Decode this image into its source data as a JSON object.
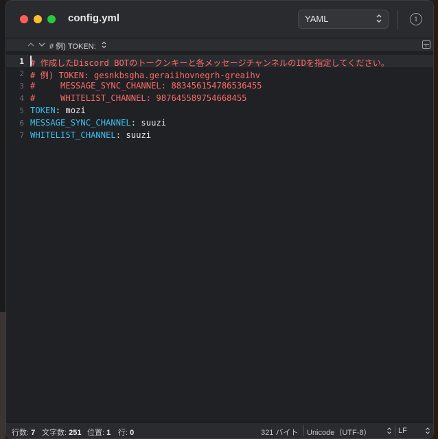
{
  "window": {
    "title": "config.yml",
    "syntax_mode": "YAML"
  },
  "navbar": {
    "breadcrumb": "# 例) TOKEN:"
  },
  "editor": {
    "current_line": 1,
    "lines": [
      {
        "number": "1",
        "comment": "# 作成したDiscord BOTのトークンキーと各メッセージチャンネルのIDを指定してください。"
      },
      {
        "number": "2",
        "comment": "# 例) TOKEN: gesnkbsgha.geraiihovnegrh-greaihv"
      },
      {
        "number": "3",
        "comment": "#     MESSAGE_SYNC_CHANNEL: 883456154786536455"
      },
      {
        "number": "4",
        "comment": "#     WHITELIST_CHANNEL: 987645589754668455"
      },
      {
        "number": "5",
        "key": "TOKEN",
        "sep": ":",
        "value": " mozi"
      },
      {
        "number": "6",
        "key": "MESSAGE_SYNC_CHANNEL",
        "sep": ":",
        "value": " suuzi"
      },
      {
        "number": "7",
        "key": "WHITELIST_CHANNEL",
        "sep": ":",
        "value": " suuzi"
      }
    ]
  },
  "status": {
    "lines_label": "行数:",
    "lines_value": "7",
    "chars_label": "文字数:",
    "chars_value": "251",
    "position_label": "位置:",
    "position_value": "1",
    "row_label": "行:",
    "row_value": "0",
    "size": "321 バイト",
    "encoding": "Unicode（UTF-8）",
    "line_ending": "LF"
  },
  "colors": {
    "comment": "#ff6b67",
    "key": "#3cc0f0",
    "text": "#e6e6e6",
    "background": "#1f2124"
  },
  "icons": [
    "close-icon",
    "minimize-icon",
    "zoom-icon",
    "chevron-updown-icon",
    "info-icon",
    "chevron-up-icon",
    "chevron-down-icon",
    "split-view-icon"
  ]
}
